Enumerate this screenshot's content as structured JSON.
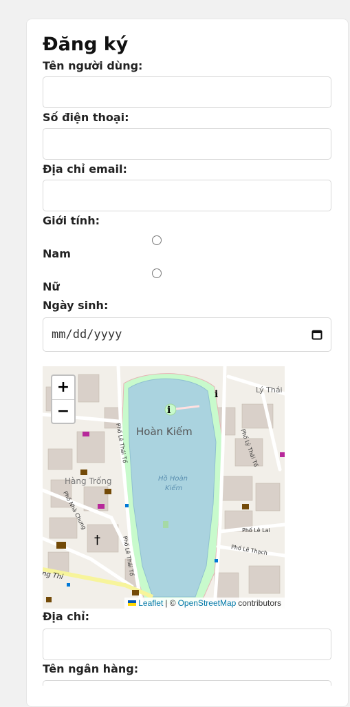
{
  "form": {
    "title": "Đăng ký",
    "username_label": "Tên người dùng:",
    "phone_label": "Số điện thoại:",
    "email_label": "Địa chỉ email:",
    "gender_label": "Giới tính:",
    "gender_options": [
      "Nam",
      "Nữ"
    ],
    "birthdate_label": "Ngày sinh:",
    "birthdate_placeholder": "mm/dd/yyyy",
    "address_label": "Địa chỉ:",
    "bank_label": "Tên ngân hàng:"
  },
  "map": {
    "zoom_in": "+",
    "zoom_out": "−",
    "lake_label": "Hoàn Kiếm",
    "lake_water_label_1": "Hồ Hoàn",
    "lake_water_label_2": "Kiếm",
    "area_label": "Hàng Trống",
    "street_ly_thai": "Lý Thái",
    "street_ly_thai_to": "Phố Lý Thái Tổ",
    "street_le_thai_to_1": "Phố Lê Thái Tổ",
    "street_le_thai_to_2": "Phố Lê Thái Tổ",
    "street_nha_chung": "Phố Nhà Chung",
    "street_le_lai": "Phố Lê Lai",
    "street_le_thach": "Phố Lê Thạch",
    "street_ng_thi": "ng Thi",
    "attribution": {
      "leaflet": "Leaflet",
      "separator": "| ©",
      "osm": "OpenStreetMap",
      "contributors": "contributors"
    },
    "colors": {
      "water": "#aad3df",
      "land": "#f2efe9",
      "park": "#c8facc",
      "road": "#ffffff",
      "building": "#d9d0c9"
    }
  }
}
